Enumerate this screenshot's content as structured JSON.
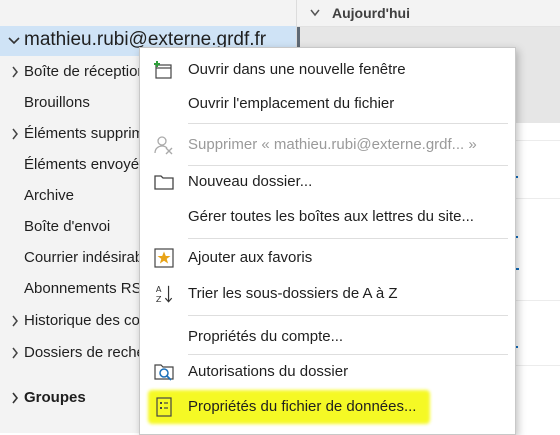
{
  "account": {
    "email": "mathieu.rubi@externe.grdf.fr"
  },
  "folders": [
    {
      "label": "Boîte de réception",
      "expandable": true
    },
    {
      "label": "Brouillons",
      "expandable": false
    },
    {
      "label": "Éléments supprimés",
      "expandable": true
    },
    {
      "label": "Éléments envoyés",
      "expandable": false
    },
    {
      "label": "Archive",
      "expandable": false
    },
    {
      "label": "Boîte d'envoi",
      "expandable": false
    },
    {
      "label": "Courrier indésirable",
      "expandable": false
    },
    {
      "label": "Abonnements RSS",
      "expandable": false
    },
    {
      "label": "Historique des conversations",
      "expandable": true
    },
    {
      "label": "Dossiers de recherche",
      "expandable": true
    }
  ],
  "groups": {
    "label": "Groupes"
  },
  "message_list": {
    "group_header": "Aujourd'hui"
  },
  "context_menu": {
    "items": [
      {
        "label": "Ouvrir dans une nouvelle fenêtre",
        "icon": "new-window-icon",
        "enabled": true
      },
      {
        "label": "Ouvrir l'emplacement du fichier",
        "icon": "",
        "enabled": true
      },
      {
        "label": "Supprimer « mathieu.rubi@externe.grdf... »",
        "icon": "remove-account-icon",
        "enabled": false
      },
      {
        "label": "Nouveau dossier...",
        "icon": "folder-icon",
        "enabled": true
      },
      {
        "label": "Gérer toutes les boîtes aux lettres du site...",
        "icon": "",
        "enabled": true
      },
      {
        "label": "Ajouter aux favoris",
        "icon": "favorite-star-icon",
        "enabled": true
      },
      {
        "label": "Trier les sous-dossiers de A à Z",
        "icon": "sort-az-icon",
        "enabled": true
      },
      {
        "label": "Propriétés du compte...",
        "icon": "",
        "enabled": true
      },
      {
        "label": "Autorisations du dossier",
        "icon": "folder-permissions-icon",
        "enabled": true
      },
      {
        "label": "Propriétés du fichier de données...",
        "icon": "data-file-properties-icon",
        "enabled": true,
        "highlighted": true
      }
    ]
  },
  "colors": {
    "account_selected_bg": "#cfe3f6",
    "highlight": "#f4f800",
    "accent": "#0f6cbd"
  }
}
